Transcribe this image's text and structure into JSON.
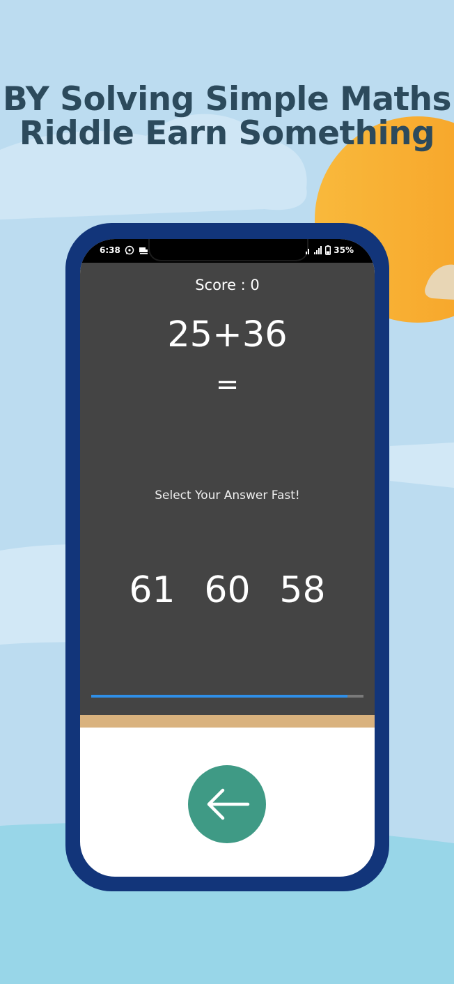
{
  "promo": {
    "headline_line1": "BY Solving Simple Maths",
    "headline_line2": "Riddle Earn Something"
  },
  "status_bar": {
    "time": "6:38",
    "battery": "35%",
    "left_icons": [
      "whatsapp-icon",
      "notification-icon"
    ],
    "right_icons": [
      "signal-icon",
      "signal-icon",
      "battery-icon"
    ]
  },
  "game": {
    "score_label": "Score : 0",
    "question": "25+36",
    "equals": "=",
    "prompt": "Select Your Answer Fast!",
    "answers": [
      "61",
      "60",
      "58"
    ],
    "timer_progress": 0.94
  },
  "navigation": {
    "back_icon": "arrow-left-icon"
  },
  "colors": {
    "sky": "#bcdcf0",
    "sun": "#f8a52a",
    "phone_frame": "#12357a",
    "game_bg": "#444444",
    "timer": "#2f8fe8",
    "accent_strip": "#d9b27e",
    "back_button": "#3f9a85",
    "headline": "#2c4a5c"
  }
}
